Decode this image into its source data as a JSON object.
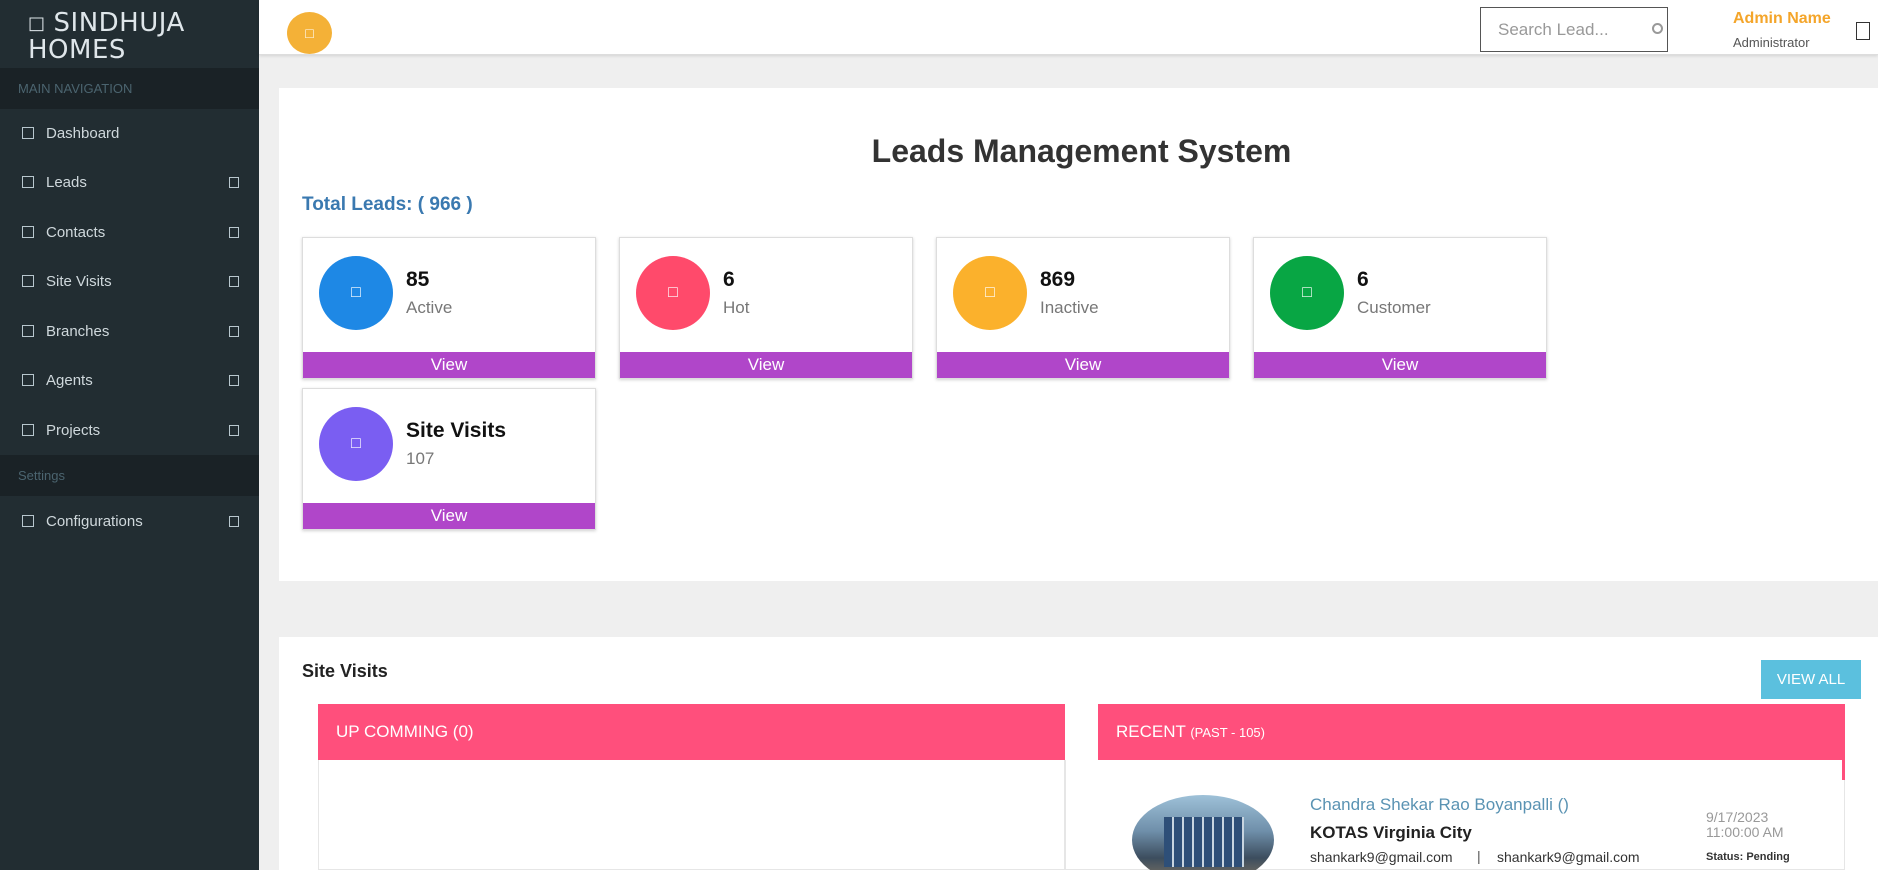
{
  "brand": {
    "icon": "home-icon",
    "name": "SINDHUJA HOMES"
  },
  "sidebar": {
    "main_nav_header": "MAIN NAVIGATION",
    "settings_header": "Settings",
    "items": [
      {
        "label": "Dashboard",
        "icon": "dashboard-icon",
        "has_submenu": false
      },
      {
        "label": "Leads",
        "icon": "leads-icon",
        "has_submenu": true
      },
      {
        "label": "Contacts",
        "icon": "contacts-icon",
        "has_submenu": true
      },
      {
        "label": "Site Visits",
        "icon": "site-visits-icon",
        "has_submenu": true
      },
      {
        "label": "Branches",
        "icon": "branches-icon",
        "has_submenu": true
      },
      {
        "label": "Agents",
        "icon": "agents-icon",
        "has_submenu": true
      },
      {
        "label": "Projects",
        "icon": "projects-icon",
        "has_submenu": true
      }
    ],
    "settings_items": [
      {
        "label": "Configurations",
        "icon": "configurations-icon",
        "has_submenu": true
      }
    ]
  },
  "topbar": {
    "search_placeholder": "Search Lead...",
    "admin_name": "Admin Name",
    "admin_role": "Administrator"
  },
  "dashboard": {
    "title": "Leads Management System",
    "total_leads_label": "Total Leads: ( 966 )",
    "cards": [
      {
        "value": "85",
        "label": "Active",
        "color": "#1e88e5",
        "button": "View"
      },
      {
        "value": "6",
        "label": "Hot",
        "color": "#ff4a6b",
        "button": "View"
      },
      {
        "value": "869",
        "label": "Inactive",
        "color": "#fbb12c",
        "button": "View"
      },
      {
        "value": "6",
        "label": "Customer",
        "color": "#08a644",
        "button": "View"
      },
      {
        "value": "Site Visits",
        "label": "107",
        "color": "#7a5ef2",
        "button": "View"
      }
    ]
  },
  "site_visits": {
    "title": "Site Visits",
    "view_all": "VIEW ALL",
    "upcoming_label": "UP COMMING (0)",
    "recent_label": "RECENT",
    "recent_count": "(PAST - 105)",
    "recent_items": [
      {
        "name": "Chandra Shekar Rao Boyanpalli ()",
        "project": "KOTAS Virginia City",
        "email1": "shankark9@gmail.com",
        "separator": "|",
        "email2": "shankark9@gmail.com",
        "date": "9/17/2023",
        "time": "11:00:00 AM",
        "status": "Status: Pending"
      }
    ]
  },
  "colors": {
    "sidebar_bg": "#222d32",
    "accent_orange": "#f4b137",
    "view_button": "#b046c9",
    "section_header": "#ff4f7c",
    "view_all_btn": "#5bc0de"
  }
}
